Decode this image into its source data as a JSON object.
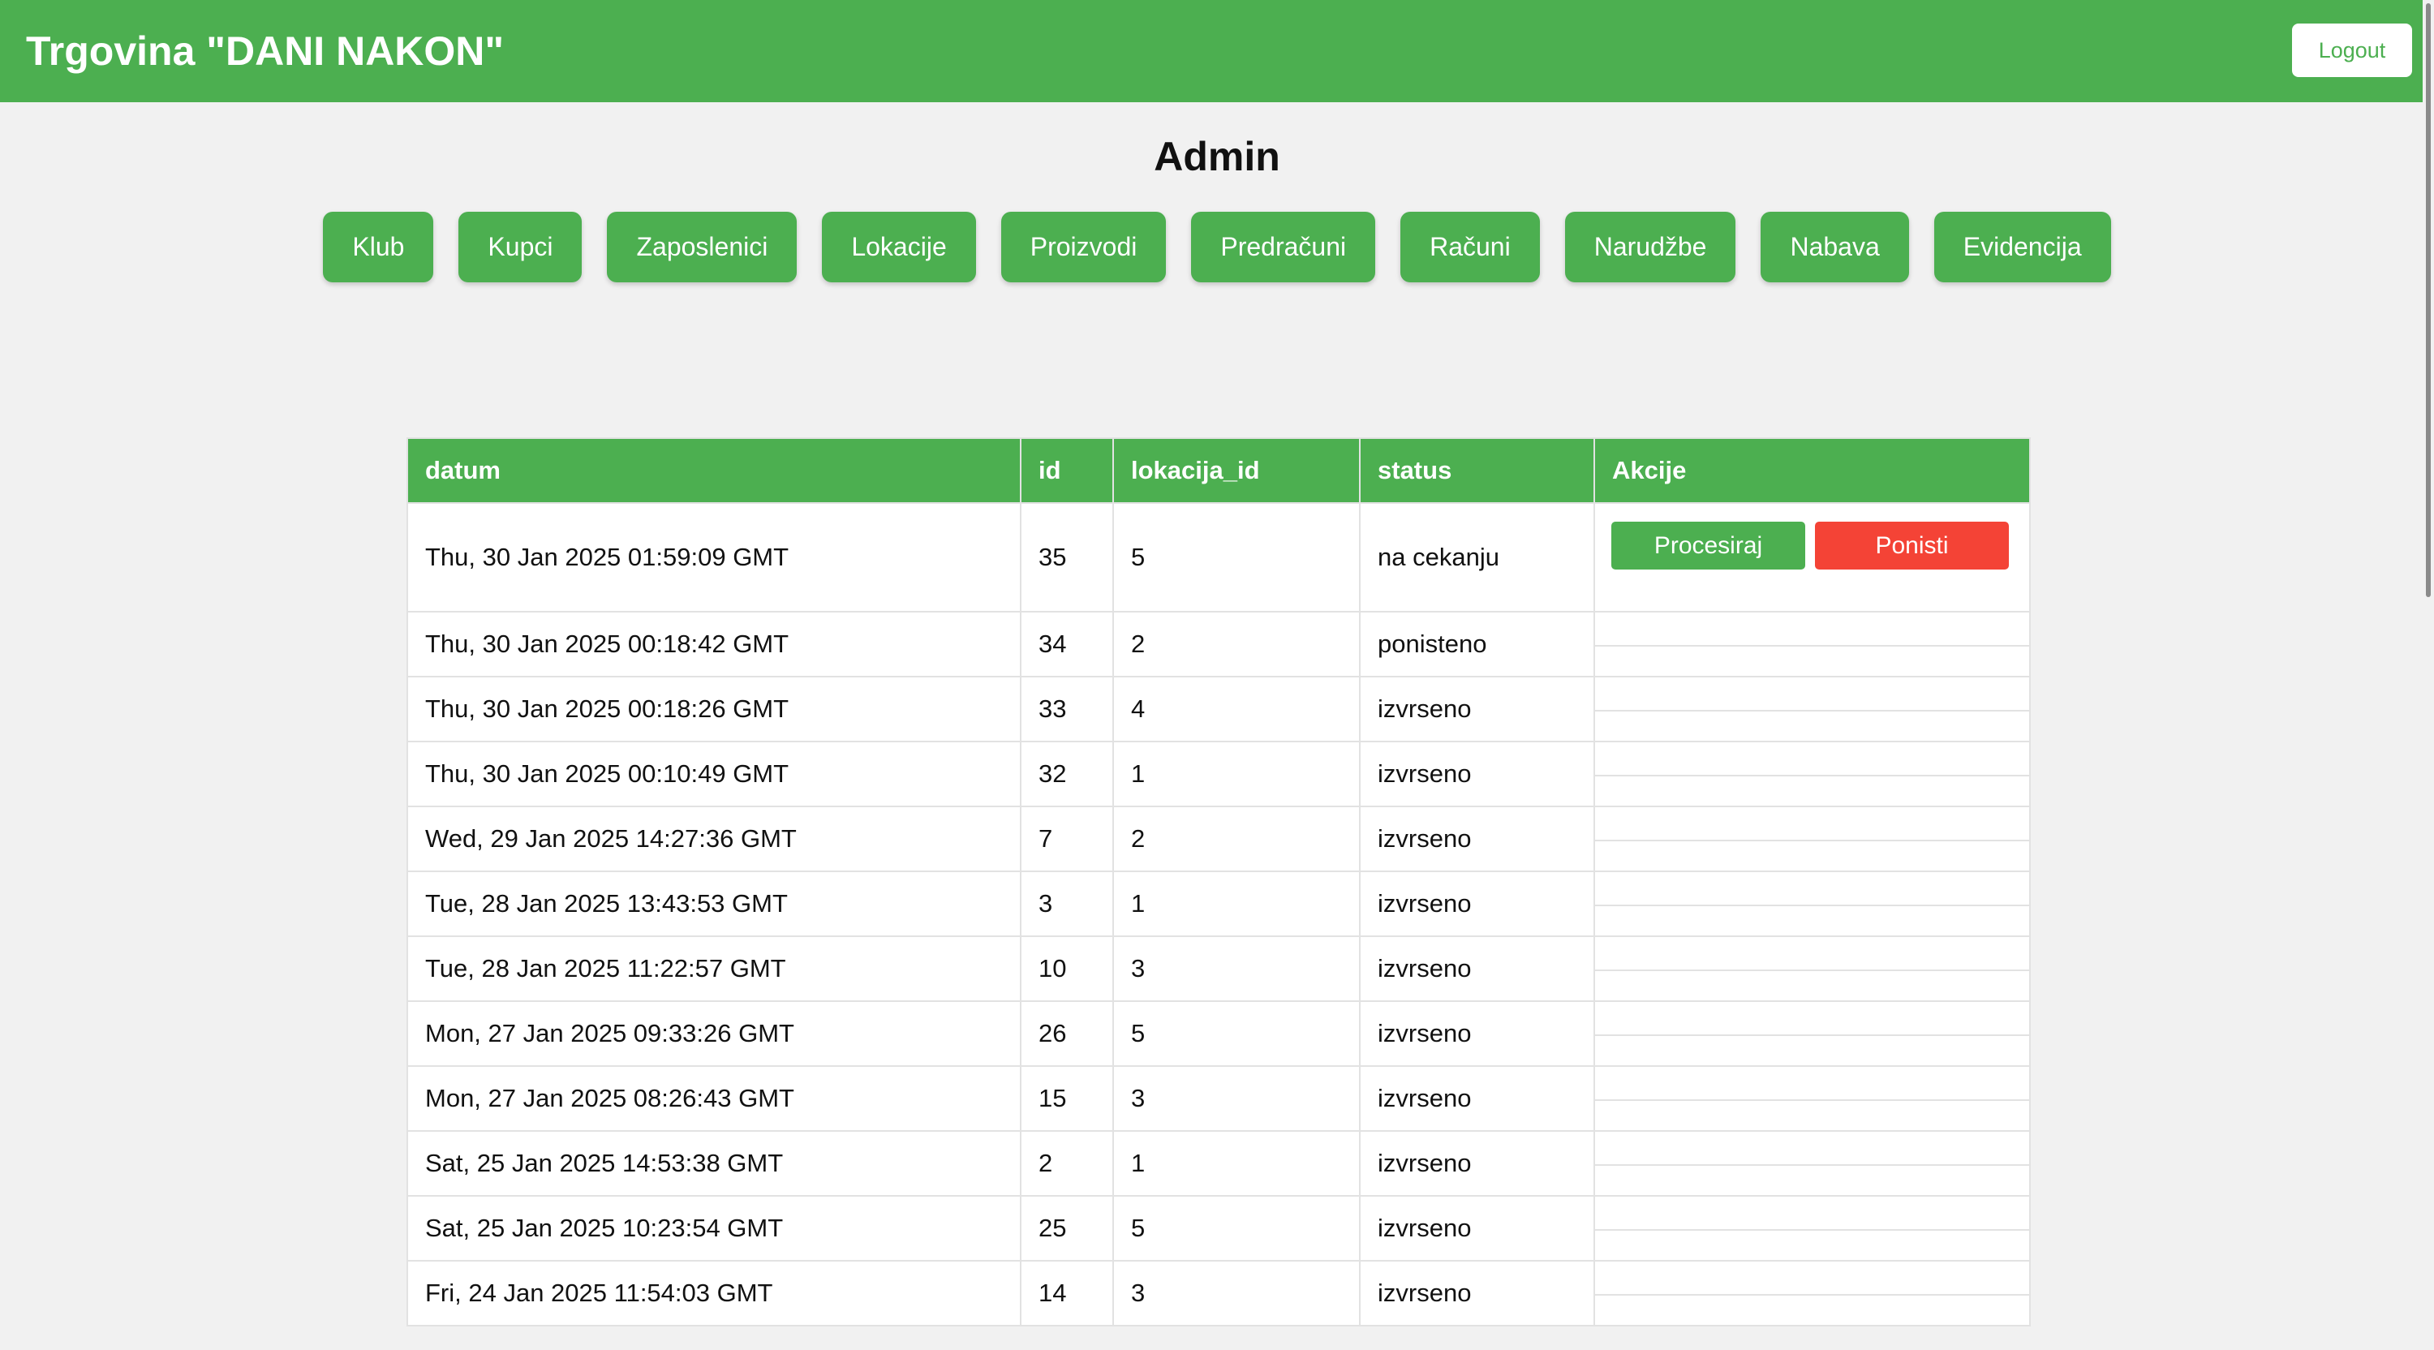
{
  "header": {
    "title": "Trgovina \"DANI NAKON\"",
    "logout_label": "Logout"
  },
  "page": {
    "title": "Admin"
  },
  "nav": [
    "Klub",
    "Kupci",
    "Zaposlenici",
    "Lokacije",
    "Proizvodi",
    "Predračuni",
    "Računi",
    "Narudžbe",
    "Nabava",
    "Evidencija"
  ],
  "table": {
    "columns": [
      "datum",
      "id",
      "lokacija_id",
      "status",
      "Akcije"
    ],
    "actions": {
      "process_label": "Procesiraj",
      "cancel_label": "Ponisti"
    },
    "rows": [
      {
        "datum": "Thu, 30 Jan 2025 01:59:09 GMT",
        "id": "35",
        "lokacija_id": "5",
        "status": "na cekanju"
      },
      {
        "datum": "Thu, 30 Jan 2025 00:18:42 GMT",
        "id": "34",
        "lokacija_id": "2",
        "status": "ponisteno"
      },
      {
        "datum": "Thu, 30 Jan 2025 00:18:26 GMT",
        "id": "33",
        "lokacija_id": "4",
        "status": "izvrseno"
      },
      {
        "datum": "Thu, 30 Jan 2025 00:10:49 GMT",
        "id": "32",
        "lokacija_id": "1",
        "status": "izvrseno"
      },
      {
        "datum": "Wed, 29 Jan 2025 14:27:36 GMT",
        "id": "7",
        "lokacija_id": "2",
        "status": "izvrseno"
      },
      {
        "datum": "Tue, 28 Jan 2025 13:43:53 GMT",
        "id": "3",
        "lokacija_id": "1",
        "status": "izvrseno"
      },
      {
        "datum": "Tue, 28 Jan 2025 11:22:57 GMT",
        "id": "10",
        "lokacija_id": "3",
        "status": "izvrseno"
      },
      {
        "datum": "Mon, 27 Jan 2025 09:33:26 GMT",
        "id": "26",
        "lokacija_id": "5",
        "status": "izvrseno"
      },
      {
        "datum": "Mon, 27 Jan 2025 08:26:43 GMT",
        "id": "15",
        "lokacija_id": "3",
        "status": "izvrseno"
      },
      {
        "datum": "Sat, 25 Jan 2025 14:53:38 GMT",
        "id": "2",
        "lokacija_id": "1",
        "status": "izvrseno"
      },
      {
        "datum": "Sat, 25 Jan 2025 10:23:54 GMT",
        "id": "25",
        "lokacija_id": "5",
        "status": "izvrseno"
      },
      {
        "datum": "Fri, 24 Jan 2025 11:54:03 GMT",
        "id": "14",
        "lokacija_id": "3",
        "status": "izvrseno"
      }
    ]
  }
}
